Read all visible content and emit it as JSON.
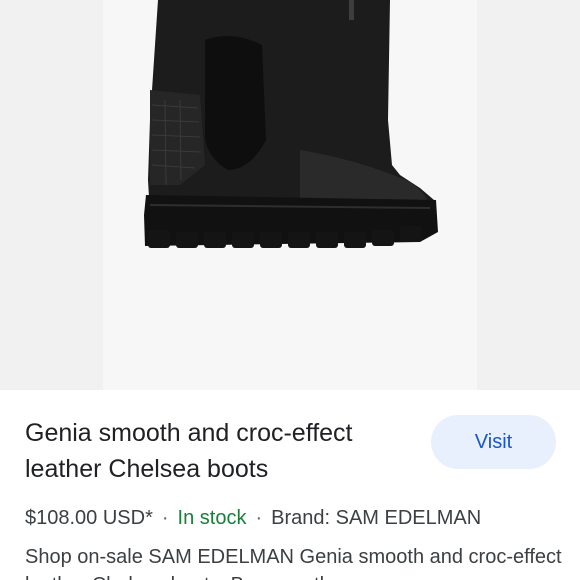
{
  "product": {
    "image_alt_icon": "boot-image",
    "title": "Genia smooth and croc-effect leather Chelsea boots",
    "visit_label": "Visit",
    "price": "$108.00 USD*",
    "separator": "·",
    "stock": "In stock",
    "brand": "Brand: SAM EDELMAN",
    "description": "Shop on-sale SAM EDELMAN Genia smooth and croc-effect leather Chelsea boots. Browse other"
  },
  "colors": {
    "accent": "#1a56c8",
    "button_bg": "#e8f0fe",
    "stock": "#188038"
  }
}
